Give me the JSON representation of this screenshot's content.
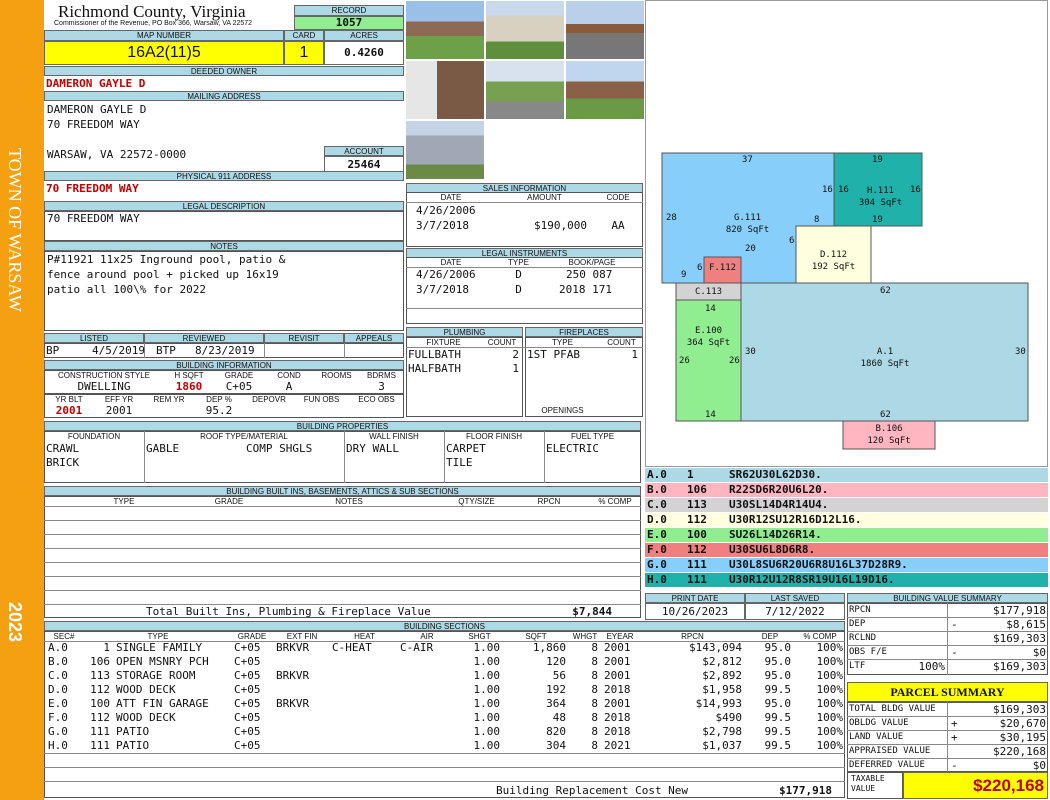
{
  "sidebar": {
    "town": "TOWN OF WARSAW",
    "year": "2023"
  },
  "header": {
    "county": "Richmond County, Virginia",
    "commissioner": "Commissioner of the Revenue, PO Box 366, Warsaw, VA 22572",
    "record_label": "RECORD",
    "record": "1057",
    "map_label": "MAP NUMBER",
    "map": "16A2(11)5",
    "card_label": "CARD",
    "card": "1",
    "acres_label": "ACRES",
    "acres": "0.4260"
  },
  "owner": {
    "deeded_label": "DEEDED OWNER",
    "deeded": "DAMERON GAYLE D",
    "mailing_label": "MAILING ADDRESS",
    "line1": "DAMERON GAYLE D",
    "line2": "70 FREEDOM WAY",
    "line3": "WARSAW, VA 22572-0000",
    "account_label": "ACCOUNT",
    "account": "25464",
    "physical_label": "PHYSICAL 911 ADDRESS",
    "physical": "70 FREEDOM WAY",
    "legal_label": "LEGAL DESCRIPTION",
    "legal": "70 FREEDOM WAY",
    "notes_label": "NOTES",
    "notes1": "P#11921 11x25 Inground pool, patio &",
    "notes2": "fence around pool + picked up 16x19",
    "notes3": "patio all 100\\% for 2022"
  },
  "listed": {
    "listed_label": "LISTED",
    "reviewed_label": "REVIEWED",
    "revisit_label": "REVISIT",
    "appeals_label": "APPEALS",
    "lister": "BP",
    "listed_date": "4/5/2019",
    "reviewer": "BTP",
    "reviewed_date": "8/23/2019"
  },
  "building_info": {
    "label": "BUILDING INFORMATION",
    "h_style": "CONSTRUCTION STYLE",
    "h_sqft": "H SQFT",
    "h_grade": "GRADE",
    "h_cond": "COND",
    "h_rooms": "ROOMS",
    "h_bdrms": "BDRMS",
    "style": "DWELLING",
    "sqft": "1860",
    "grade": "C+05",
    "cond": "A",
    "bdrms": "3",
    "h_yrblt": "YR BLT",
    "h_effyr": "EFF YR",
    "h_remyr": "REM YR",
    "h_dep": "DEP %",
    "h_depovr": "DEPOVR",
    "h_funobs": "FUN OBS",
    "h_ecoobs": "ECO OBS",
    "yrblt": "2001",
    "effyr": "2001",
    "dep": "95.2"
  },
  "sales": {
    "label": "SALES INFORMATION",
    "h_date": "DATE",
    "h_amount": "AMOUNT",
    "h_code": "CODE",
    "rows": [
      {
        "date": "4/26/2006",
        "amount": "",
        "code": ""
      },
      {
        "date": "3/7/2018",
        "amount": "$190,000",
        "code": "AA"
      }
    ]
  },
  "instruments": {
    "label": "LEGAL INSTRUMENTS",
    "h_date": "DATE",
    "h_type": "TYPE",
    "h_book": "BOOK/PAGE",
    "rows": [
      {
        "date": "4/26/2006",
        "type": "D",
        "book": "250 087"
      },
      {
        "date": "3/7/2018",
        "type": "D",
        "book": "2018 171"
      }
    ]
  },
  "plumbing": {
    "label": "PLUMBING",
    "h_fixture": "FIXTURE",
    "h_count": "COUNT",
    "r1_fix": "FULLBATH",
    "r1_cnt": "2",
    "r2_fix": "HALFBATH",
    "r2_cnt": "1"
  },
  "fireplaces": {
    "label": "FIREPLACES",
    "h_type": "TYPE",
    "h_count": "COUNT",
    "r1_type": "1ST PFAB",
    "r1_cnt": "1",
    "openings_label": "OPENINGS"
  },
  "properties": {
    "label": "BUILDING PROPERTIES",
    "h_foundation": "FOUNDATION",
    "h_roof": "ROOF TYPE/MATERIAL",
    "h_wall": "WALL FINISH",
    "h_floor": "FLOOR FINISH",
    "h_fuel": "FUEL TYPE",
    "foundation1": "CRAWL",
    "foundation2": "BRICK",
    "roof_type": "GABLE",
    "roof_material": "COMP SHGLS",
    "wall": "DRY WALL",
    "floor1": "CARPET",
    "floor2": "TILE",
    "fuel": "ELECTRIC"
  },
  "builtins": {
    "label": "BUILDING BUILT INS, BASEMENTS, ATTICS & SUB SECTIONS",
    "h_type": "TYPE",
    "h_grade": "GRADE",
    "h_notes": "NOTES",
    "h_qty": "QTY/SIZE",
    "h_rpcn": "RPCN",
    "h_comp": "% COMP",
    "total_label": "Total Built Ins, Plumbing & Fireplace Value",
    "total": "$7,844"
  },
  "print": {
    "print_label": "PRINT DATE",
    "saved_label": "LAST SAVED",
    "print_date": "10/26/2023",
    "saved_date": "7/12/2022"
  },
  "sections": {
    "label": "BUILDING SECTIONS",
    "h_sec": "SEC#",
    "h_type": "TYPE",
    "h_grade": "GRADE",
    "h_extfin": "EXT FIN",
    "h_heat": "HEAT",
    "h_air": "AIR",
    "h_shgt": "SHGT",
    "h_sqft": "SQFT",
    "h_whgt": "WHGT",
    "h_eyear": "EYEAR",
    "h_rpcn": "RPCN",
    "h_dep": "DEP",
    "h_comp": "% COMP",
    "rows": [
      {
        "sec": "A.0",
        "code": "1",
        "type": "SINGLE FAMILY",
        "grade": "C+05",
        "ext": "BRKVR",
        "heat": "C-HEAT",
        "air": "C-AIR",
        "shgt": "1.00",
        "sqft": "1,860",
        "whgt": "8",
        "eyear": "2001",
        "rpcn": "$143,094",
        "dep": "95.0",
        "comp": "100%"
      },
      {
        "sec": "B.0",
        "code": "106",
        "type": "OPEN MSNRY PCH",
        "grade": "C+05",
        "ext": "",
        "heat": "",
        "air": "",
        "shgt": "1.00",
        "sqft": "120",
        "whgt": "8",
        "eyear": "2001",
        "rpcn": "$2,812",
        "dep": "95.0",
        "comp": "100%"
      },
      {
        "sec": "C.0",
        "code": "113",
        "type": "STORAGE ROOM",
        "grade": "C+05",
        "ext": "BRKVR",
        "heat": "",
        "air": "",
        "shgt": "1.00",
        "sqft": "56",
        "whgt": "8",
        "eyear": "2001",
        "rpcn": "$2,892",
        "dep": "95.0",
        "comp": "100%"
      },
      {
        "sec": "D.0",
        "code": "112",
        "type": "WOOD DECK",
        "grade": "C+05",
        "ext": "",
        "heat": "",
        "air": "",
        "shgt": "1.00",
        "sqft": "192",
        "whgt": "8",
        "eyear": "2018",
        "rpcn": "$1,958",
        "dep": "99.5",
        "comp": "100%"
      },
      {
        "sec": "E.0",
        "code": "100",
        "type": "ATT FIN GARAGE",
        "grade": "C+05",
        "ext": "BRKVR",
        "heat": "",
        "air": "",
        "shgt": "1.00",
        "sqft": "364",
        "whgt": "8",
        "eyear": "2001",
        "rpcn": "$14,993",
        "dep": "95.0",
        "comp": "100%"
      },
      {
        "sec": "F.0",
        "code": "112",
        "type": "WOOD DECK",
        "grade": "C+05",
        "ext": "",
        "heat": "",
        "air": "",
        "shgt": "1.00",
        "sqft": "48",
        "whgt": "8",
        "eyear": "2018",
        "rpcn": "$490",
        "dep": "99.5",
        "comp": "100%"
      },
      {
        "sec": "G.0",
        "code": "111",
        "type": "PATIO",
        "grade": "C+05",
        "ext": "",
        "heat": "",
        "air": "",
        "shgt": "1.00",
        "sqft": "820",
        "whgt": "8",
        "eyear": "2018",
        "rpcn": "$2,798",
        "dep": "99.5",
        "comp": "100%"
      },
      {
        "sec": "H.0",
        "code": "111",
        "type": "PATIO",
        "grade": "C+05",
        "ext": "",
        "heat": "",
        "air": "",
        "shgt": "1.00",
        "sqft": "304",
        "whgt": "8",
        "eyear": "2021",
        "rpcn": "$1,037",
        "dep": "99.5",
        "comp": "100%"
      }
    ],
    "replacement_label": "Building Replacement Cost New",
    "replacement": "$177,918"
  },
  "sketch_legend": [
    {
      "sec": "A.0",
      "code": "1",
      "desc": "SR62U30L62D30.",
      "color": "#add8e6"
    },
    {
      "sec": "B.0",
      "code": "106",
      "desc": "R22SD6R20U6L20.",
      "color": "#ffb6c1"
    },
    {
      "sec": "C.0",
      "code": "113",
      "desc": "U30SL14D4R14U4.",
      "color": "#d3d3d3"
    },
    {
      "sec": "D.0",
      "code": "112",
      "desc": "U30R12SU12R16D12L16.",
      "color": "#ffffe0"
    },
    {
      "sec": "E.0",
      "code": "100",
      "desc": "SU26L14D26R14.",
      "color": "#90ee90"
    },
    {
      "sec": "F.0",
      "code": "112",
      "desc": "U30SU6L8D6R8.",
      "color": "#f08080"
    },
    {
      "sec": "G.0",
      "code": "111",
      "desc": "U30L8SU6R20U6R8U16L37D28R9.",
      "color": "#87cefa"
    },
    {
      "sec": "H.0",
      "code": "111",
      "desc": "U30R12U12R8SR19U16L19D16.",
      "color": "#20b2aa"
    }
  ],
  "sketch": {
    "a": {
      "label": "A.1",
      "area": "1860 SqFt",
      "top": "62",
      "bottom": "62",
      "left": "30",
      "right": "30"
    },
    "b": {
      "label": "B.106",
      "area": "120 SqFt"
    },
    "c": {
      "label": "C.113",
      "dim": "14"
    },
    "d": {
      "label": "D.112",
      "area": "192 SqFt"
    },
    "e": {
      "label": "E.100",
      "area": "364 SqFt",
      "left": "26",
      "right": "26",
      "bottom": "14"
    },
    "f": {
      "label": "F.112",
      "dim": "6"
    },
    "g": {
      "label": "G.111",
      "area": "820 SqFt",
      "top": "37",
      "left": "28",
      "d1": "16",
      "d2": "8",
      "d3": "20",
      "d4": "6",
      "d5": "9"
    },
    "h": {
      "label": "H.111",
      "area": "304 SqFt",
      "top": "19",
      "bottom": "19",
      "left": "16",
      "right": "16"
    }
  },
  "value_summary": {
    "label": "BUILDING VALUE SUMMARY",
    "rpcn_label": "RPCN",
    "rpcn": "$177,918",
    "dep_label": "DEP",
    "dep_sign": "-",
    "dep": "$8,615",
    "rcnld_label": "RCLND",
    "rcnld": "$169,303",
    "obs_label": "OBS F/E",
    "obs_sign": "-",
    "obs": "$0",
    "ltf_label": "LTF",
    "ltf_pct": "100%",
    "ltf": "$169,303"
  },
  "parcel_summary": {
    "label": "PARCEL SUMMARY",
    "total_bldg_label": "TOTAL BLDG VALUE",
    "total_bldg": "$169,303",
    "obldg_label": "OBLDG VALUE",
    "obldg_sign": "+",
    "obldg": "$20,670",
    "land_label": "LAND VALUE",
    "land_sign": "+",
    "land": "$30,195",
    "appraised_label": "APPRAISED VALUE",
    "appraised": "$220,168",
    "deferred_label": "DEFERRED VALUE",
    "deferred_sign": "-",
    "deferred": "$0",
    "taxable_label": "TAXABLE VALUE",
    "taxable": "$220,168"
  },
  "colors": {
    "sidebar": "#f5a011",
    "header_bg": "#add8e6",
    "highlight": "#ffff00",
    "record_bg": "#90ee90",
    "accent_red": "#c00000"
  }
}
